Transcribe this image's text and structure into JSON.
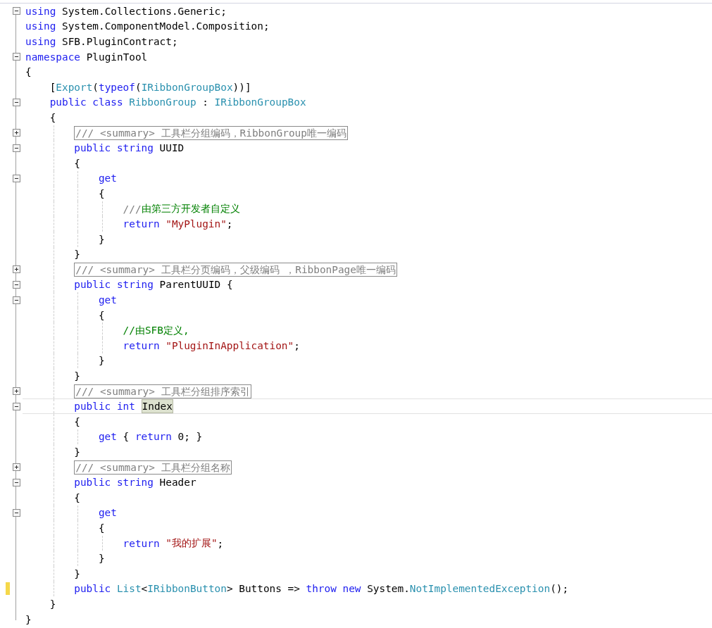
{
  "lines": [
    {
      "expanded": true,
      "tokens": [
        {
          "kind": "keyword",
          "text": "using"
        },
        {
          "kind": "plain",
          "text": " System.Collections.Generic;"
        }
      ]
    },
    {
      "tokens": [
        {
          "kind": "keyword",
          "text": "using"
        },
        {
          "kind": "plain",
          "text": " System.ComponentModel.Composition;"
        }
      ]
    },
    {
      "tokens": [
        {
          "kind": "keyword",
          "text": "using"
        },
        {
          "kind": "plain",
          "text": " SFB.PluginContract;"
        }
      ]
    },
    {
      "expanded": true,
      "tokens": [
        {
          "kind": "keyword",
          "text": "namespace"
        },
        {
          "kind": "plain",
          "text": " PluginTool"
        }
      ]
    },
    {
      "tokens": [
        {
          "kind": "plain",
          "text": "{"
        }
      ],
      "children": [
        {
          "tokens": [
            {
              "kind": "plain",
              "text": "["
            },
            {
              "kind": "type",
              "text": "Export"
            },
            {
              "kind": "plain",
              "text": "("
            },
            {
              "kind": "keyword",
              "text": "typeof"
            },
            {
              "kind": "plain",
              "text": "("
            },
            {
              "kind": "type",
              "text": "IRibbonGroupBox"
            },
            {
              "kind": "plain",
              "text": "))]"
            }
          ]
        },
        {
          "expanded": true,
          "tokens": [
            {
              "kind": "keyword",
              "text": "public class "
            },
            {
              "kind": "type",
              "text": "RibbonGroup"
            },
            {
              "kind": "plain",
              "text": " : "
            },
            {
              "kind": "type",
              "text": "IRibbonGroupBox"
            }
          ]
        },
        {
          "tokens": [
            {
              "kind": "plain",
              "text": "{"
            }
          ],
          "children": [
            {
              "expanded": false,
              "tokens": [
                {
                  "kind": "doc",
                  "text": "/// <summary> 工具栏分组编码，RibbonGroup唯一编码"
                }
              ]
            },
            {
              "expanded": true,
              "tokens": [
                {
                  "kind": "keyword",
                  "text": "public string"
                },
                {
                  "kind": "plain",
                  "text": " UUID"
                }
              ]
            },
            {
              "tokens": [
                {
                  "kind": "plain",
                  "text": "{"
                }
              ],
              "children": [
                {
                  "expanded": true,
                  "tokens": [
                    {
                      "kind": "keyword",
                      "text": "get"
                    }
                  ]
                },
                {
                  "tokens": [
                    {
                      "kind": "plain",
                      "text": "{"
                    }
                  ],
                  "children": [
                    {
                      "tokens": [
                        {
                          "kind": "docmark",
                          "text": "///"
                        },
                        {
                          "kind": "comment",
                          "text": "由第三方开发者自定义"
                        }
                      ]
                    },
                    {
                      "tokens": [
                        {
                          "kind": "keyword",
                          "text": "return "
                        },
                        {
                          "kind": "string",
                          "text": "\"MyPlugin\""
                        },
                        {
                          "kind": "plain",
                          "text": ";"
                        }
                      ]
                    }
                  ]
                },
                {
                  "tokens": [
                    {
                      "kind": "plain",
                      "text": "}"
                    }
                  ]
                }
              ]
            },
            {
              "tokens": [
                {
                  "kind": "plain",
                  "text": "}"
                }
              ]
            },
            {
              "expanded": false,
              "tokens": [
                {
                  "kind": "doc",
                  "text": "/// <summary> 工具栏分页编码，父级编码 ，RibbonPage唯一编码"
                }
              ]
            },
            {
              "expanded": true,
              "tokens": [
                {
                  "kind": "keyword",
                  "text": "public string"
                },
                {
                  "kind": "plain",
                  "text": " ParentUUID {"
                }
              ],
              "children": [
                {
                  "expanded": true,
                  "tokens": [
                    {
                      "kind": "keyword",
                      "text": "get"
                    }
                  ]
                },
                {
                  "tokens": [
                    {
                      "kind": "plain",
                      "text": "{"
                    }
                  ],
                  "children": [
                    {
                      "tokens": [
                        {
                          "kind": "comment",
                          "text": "//由SFB定义,"
                        }
                      ]
                    },
                    {
                      "tokens": [
                        {
                          "kind": "keyword",
                          "text": "return "
                        },
                        {
                          "kind": "string",
                          "text": "\"PluginInApplication\""
                        },
                        {
                          "kind": "plain",
                          "text": ";"
                        }
                      ]
                    }
                  ]
                },
                {
                  "tokens": [
                    {
                      "kind": "plain",
                      "text": "}"
                    }
                  ]
                }
              ]
            },
            {
              "tokens": [
                {
                  "kind": "plain",
                  "text": "}"
                }
              ]
            },
            {
              "expanded": false,
              "tokens": [
                {
                  "kind": "doc",
                  "text": "/// <summary> 工具栏分组排序索引"
                }
              ]
            },
            {
              "expanded": true,
              "current": true,
              "tokens": [
                {
                  "kind": "keyword",
                  "text": "public int "
                },
                {
                  "kind": "highlight",
                  "text": "Index"
                }
              ]
            },
            {
              "tokens": [
                {
                  "kind": "plain",
                  "text": "{"
                }
              ],
              "children": [
                {
                  "tokens": [
                    {
                      "kind": "keyword",
                      "text": "get"
                    },
                    {
                      "kind": "plain",
                      "text": " { "
                    },
                    {
                      "kind": "keyword",
                      "text": "return"
                    },
                    {
                      "kind": "plain",
                      "text": " 0; }"
                    }
                  ]
                }
              ]
            },
            {
              "tokens": [
                {
                  "kind": "plain",
                  "text": "}"
                }
              ]
            },
            {
              "expanded": false,
              "tokens": [
                {
                  "kind": "doc",
                  "text": "/// <summary> 工具栏分组名称"
                }
              ]
            },
            {
              "expanded": true,
              "tokens": [
                {
                  "kind": "keyword",
                  "text": "public string"
                },
                {
                  "kind": "plain",
                  "text": " Header"
                }
              ]
            },
            {
              "tokens": [
                {
                  "kind": "plain",
                  "text": "{"
                }
              ],
              "children": [
                {
                  "expanded": true,
                  "tokens": [
                    {
                      "kind": "keyword",
                      "text": "get"
                    }
                  ]
                },
                {
                  "tokens": [
                    {
                      "kind": "plain",
                      "text": "{"
                    }
                  ],
                  "children": [
                    {
                      "tokens": [
                        {
                          "kind": "keyword",
                          "text": "return "
                        },
                        {
                          "kind": "string",
                          "text": "\"我的扩展\""
                        },
                        {
                          "kind": "plain",
                          "text": ";"
                        }
                      ]
                    }
                  ]
                },
                {
                  "tokens": [
                    {
                      "kind": "plain",
                      "text": "}"
                    }
                  ]
                }
              ]
            },
            {
              "tokens": [
                {
                  "kind": "plain",
                  "text": "}"
                }
              ]
            },
            {
              "changed": true,
              "tokens": [
                {
                  "kind": "keyword",
                  "text": "public "
                },
                {
                  "kind": "type",
                  "text": "List"
                },
                {
                  "kind": "plain",
                  "text": "<"
                },
                {
                  "kind": "type",
                  "text": "IRibbonButton"
                },
                {
                  "kind": "plain",
                  "text": "> Buttons => "
                },
                {
                  "kind": "keyword",
                  "text": "throw new"
                },
                {
                  "kind": "plain",
                  "text": " System."
                },
                {
                  "kind": "type",
                  "text": "NotImplementedException"
                },
                {
                  "kind": "plain",
                  "text": "();"
                }
              ]
            }
          ]
        },
        {
          "tokens": [
            {
              "kind": "plain",
              "text": "}"
            }
          ]
        }
      ]
    },
    {
      "tokens": [
        {
          "kind": "plain",
          "text": "}"
        }
      ]
    }
  ]
}
